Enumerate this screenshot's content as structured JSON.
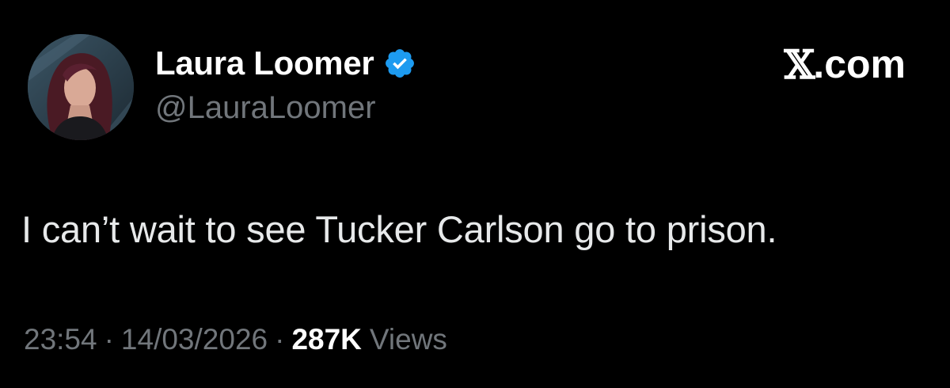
{
  "author": {
    "name": "Laura Loomer",
    "handle": "@LauraLoomer",
    "verified_badge_icon": "verified-checkmark-icon",
    "verified_color": "#1d9bf0"
  },
  "site": {
    "logo_icon": "x-logo-icon",
    "logo_mark": "𝕏",
    "domain": ".com"
  },
  "tweet": {
    "text": "I can’t wait to see Tucker Carlson go to prison."
  },
  "meta": {
    "time": "23:54",
    "separator": "·",
    "date": "14/03/2026",
    "views_count": "287K",
    "views_label": "Views"
  },
  "colors": {
    "background": "#000000",
    "text_primary": "#e7e9ea",
    "text_secondary": "#71767b"
  }
}
